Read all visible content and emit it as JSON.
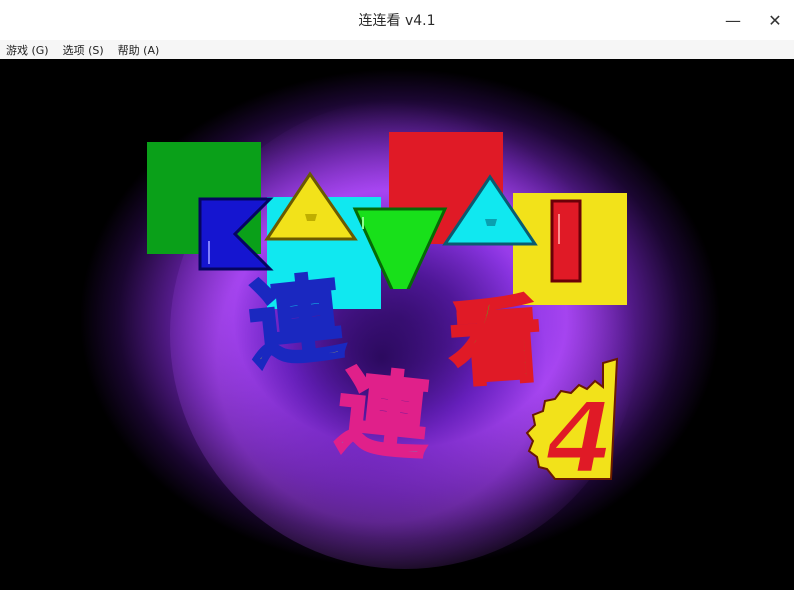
{
  "window": {
    "title": "连连看 v4.1",
    "minimize_glyph": "—",
    "close_glyph": "✕"
  },
  "menu": {
    "items": [
      {
        "label": "游戏 (G)"
      },
      {
        "label": "选项 (S)"
      },
      {
        "label": "帮助 (A)"
      }
    ]
  },
  "splash": {
    "logo_letters": [
      "K",
      "A",
      "W",
      "A",
      "I"
    ],
    "chinese_chars": [
      "連",
      "連",
      "看"
    ],
    "version_number": "4"
  },
  "colors": {
    "green": "#0aa019",
    "cyan": "#10e8f0",
    "red": "#e01a26",
    "yellow": "#f2e21a",
    "blue": "#1515d0",
    "magenta": "#e0208a"
  }
}
